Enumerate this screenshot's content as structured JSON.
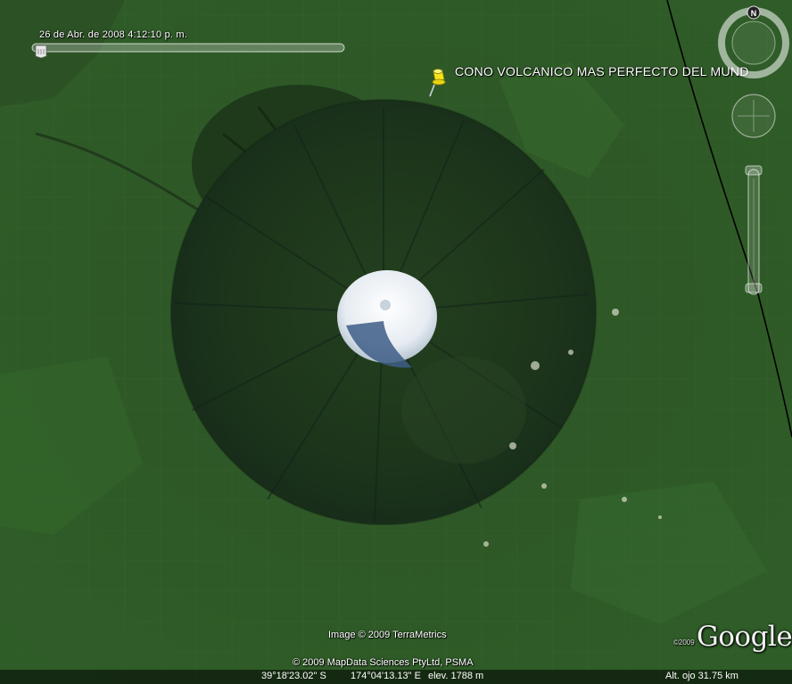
{
  "map": {
    "time": {
      "label": "26 de Abr. de 2008   4:12:10 p. m."
    },
    "placemark": {
      "label": "CONO VOLCANICO MAS PERFECTO DEL MUND"
    },
    "credits": {
      "image": "Image © 2009 TerraMetrics",
      "data": "© 2009 MapData Sciences PtyLtd, PSMA"
    },
    "logo": {
      "year": "©2009",
      "word": "Google"
    },
    "status": {
      "lat": "39°18'23.02\" S",
      "lon": "174°04'13.13\" E",
      "elev": "elev.  1788 m",
      "eye": "Alt. ojo    31.75 km"
    },
    "compass": {
      "north": "N"
    },
    "colors": {
      "farmland": "#2f5a27",
      "forest": "#1c3a1a",
      "snow": "#f2f4f6",
      "pin": "#f5e61a",
      "border": "#000000"
    },
    "icons": [
      "pushpin-icon",
      "compass-ring-icon",
      "look-joystick-icon",
      "zoom-slider-icon"
    ]
  }
}
